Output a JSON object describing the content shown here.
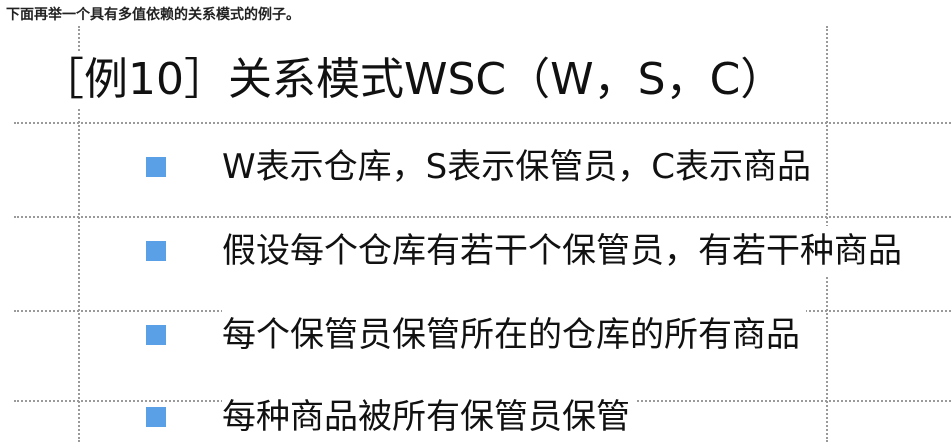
{
  "intro_text": "下面再举一个具有多值依赖的关系模式的例子。",
  "slide": {
    "title": "［例10］关系模式WSC（W，S，C）",
    "bullet_color": "#5aa0e6",
    "bullets": [
      {
        "text": "W表示仓库，S表示保管员，C表示商品"
      },
      {
        "text": "假设每个仓库有若干个保管员，有若干种商品"
      },
      {
        "text": "每个保管员保管所在的仓库的所有商品"
      },
      {
        "text": "每种商品被所有保管员保管"
      }
    ]
  }
}
